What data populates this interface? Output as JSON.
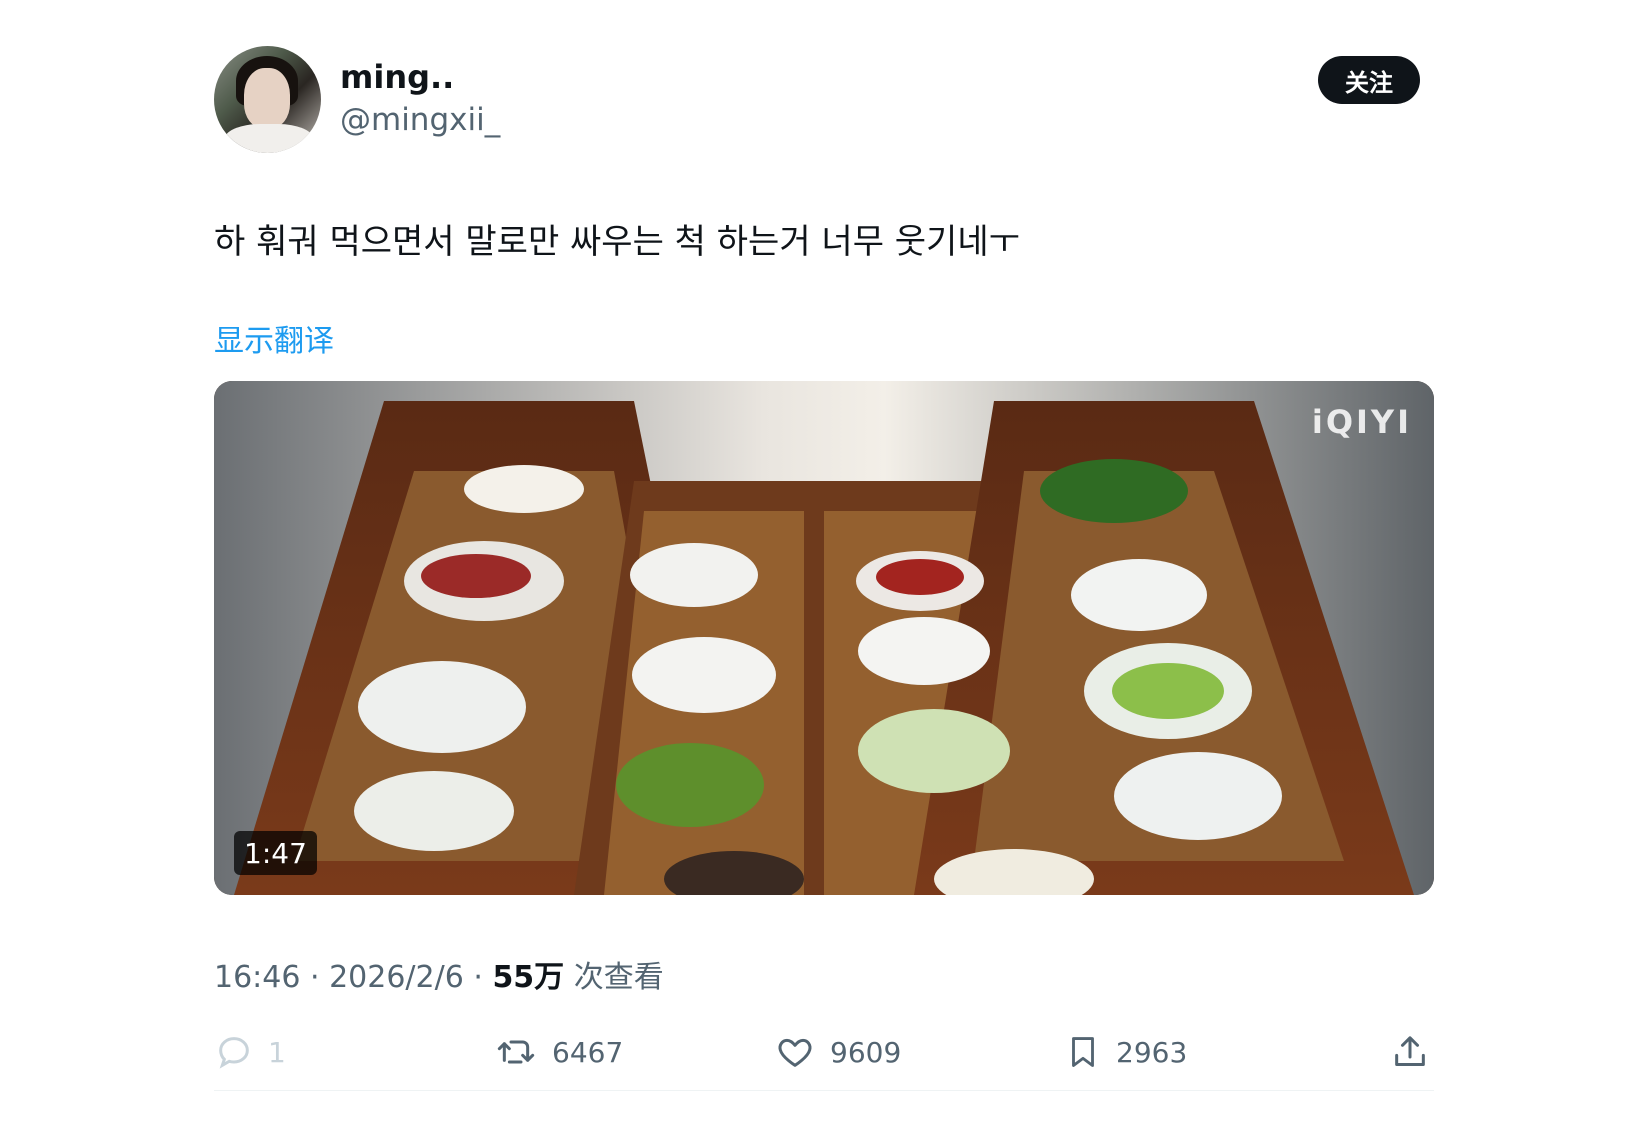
{
  "author": {
    "display_name": "ming..",
    "handle": "@mingxii_"
  },
  "follow_label": "关注",
  "tweet": {
    "text": "하 훠궈 먹으면서 말로만 싸우는 척 하는거 너무 웃기네ㅜ",
    "translate_label": "显示翻译"
  },
  "media": {
    "duration": "1:47",
    "watermark": "iQIYI"
  },
  "meta": {
    "time": "16:46",
    "sep1": " · ",
    "date": "2026/2/6",
    "sep2": " · ",
    "views": "55万",
    "views_suffix": " 次查看"
  },
  "actions": {
    "reply": {
      "icon": "reply-icon",
      "count": "1"
    },
    "retweet": {
      "icon": "retweet-icon",
      "count": "6467"
    },
    "like": {
      "icon": "heart-icon",
      "count": "9609"
    },
    "bookmark": {
      "icon": "bookmark-icon",
      "count": "2963"
    },
    "share": {
      "icon": "share-icon"
    }
  },
  "colors": {
    "link": "#1d9bf0",
    "text": "#0f1419",
    "secondary": "#536471",
    "follow_bg": "#0f1419"
  }
}
